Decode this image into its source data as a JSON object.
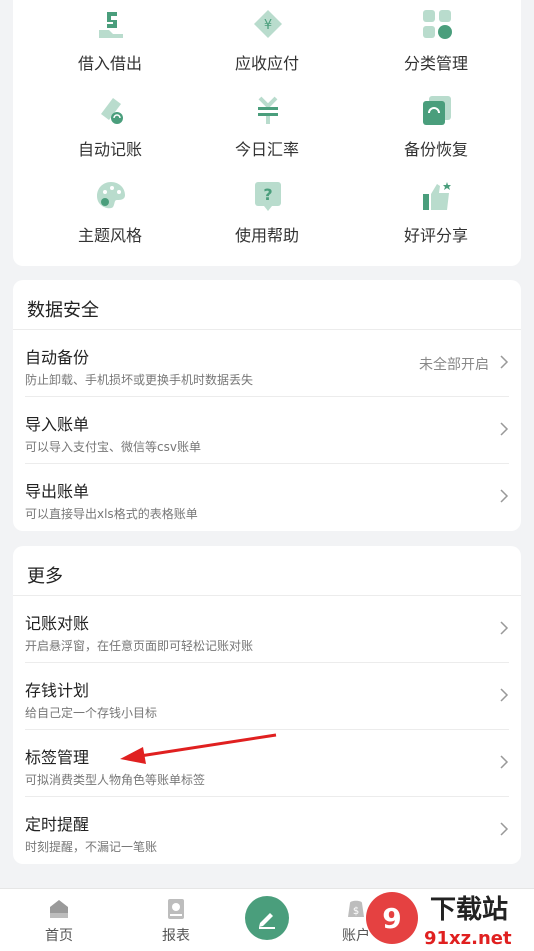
{
  "tools": [
    {
      "label": "借入借出",
      "icon": "lend-borrow-icon"
    },
    {
      "label": "应收应付",
      "icon": "receivable-icon"
    },
    {
      "label": "分类管理",
      "icon": "category-icon"
    },
    {
      "label": "自动记账",
      "icon": "auto-record-icon"
    },
    {
      "label": "今日汇率",
      "icon": "exchange-rate-icon"
    },
    {
      "label": "备份恢复",
      "icon": "backup-icon"
    },
    {
      "label": "主题风格",
      "icon": "palette-icon"
    },
    {
      "label": "使用帮助",
      "icon": "help-icon"
    },
    {
      "label": "好评分享",
      "icon": "thumbs-up-icon"
    }
  ],
  "data_security": {
    "title": "数据安全",
    "items": [
      {
        "title": "自动备份",
        "subtitle": "防止卸载、手机损坏或更换手机时数据丢失",
        "status": "未全部开启"
      },
      {
        "title": "导入账单",
        "subtitle": "可以导入支付宝、微信等csv账单"
      },
      {
        "title": "导出账单",
        "subtitle": "可以直接导出xls格式的表格账单"
      }
    ]
  },
  "more": {
    "title": "更多",
    "items": [
      {
        "title": "记账对账",
        "subtitle": "开启悬浮窗，在任意页面即可轻松记账对账"
      },
      {
        "title": "存钱计划",
        "subtitle": "给自己定一个存钱小目标"
      },
      {
        "title": "标签管理",
        "subtitle": "可拟消费类型人物角色等账单标签"
      },
      {
        "title": "定时提醒",
        "subtitle": "时刻提醒，不漏记一笔账"
      }
    ]
  },
  "tabbar": {
    "home": "首页",
    "report": "报表",
    "account": "账户"
  },
  "watermark": {
    "text1": "下载站",
    "text2": "91xz.net"
  },
  "colors": {
    "accent": "#4a9e7c",
    "accent_light": "#b9dccd",
    "arrow": "#e02020",
    "background": "#f2f3f5"
  }
}
